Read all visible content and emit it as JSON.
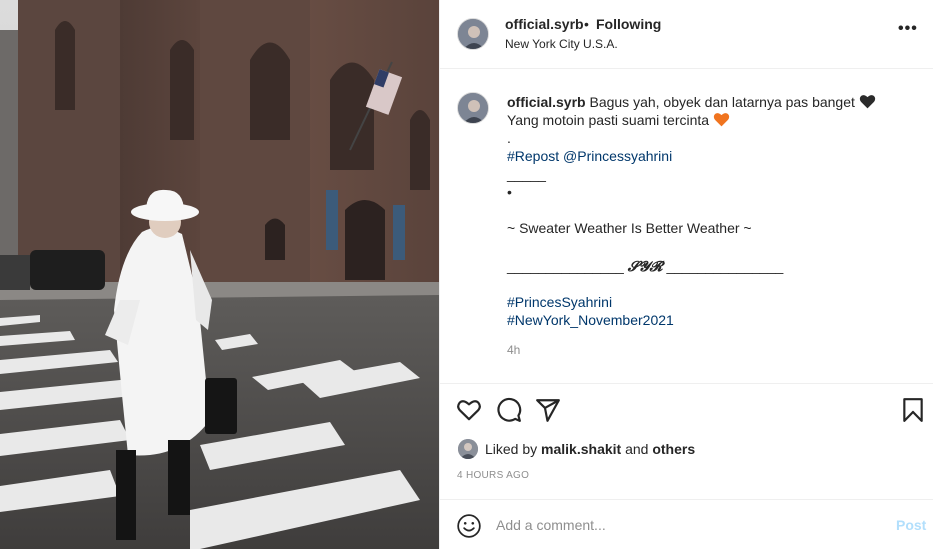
{
  "post": {
    "username": "official.syrb",
    "separator": "•",
    "follow_status": "Following",
    "location": "New York City U.S.A.",
    "more_label": "•••"
  },
  "caption": {
    "username": "official.syrb",
    "line1_text": "Bagus yah, obyek dan latarnya pas banget",
    "line2_text": "Yang motoin pasti suami tercinta",
    "line3": ".",
    "repost_tag": "#Repost",
    "repost_mention": "@Princessyahrini",
    "line5": "_____",
    "line6": "•",
    "line8": "~ Sweater Weather Is Better Weather ~",
    "syr_left": "_______________",
    "syr_mid": "𝓢𝓨𝓡",
    "syr_right": "_______________",
    "hashtag1": "#PrincesSyahrini",
    "hashtag2": "#NewYork_November2021",
    "time": "4h"
  },
  "actions": {
    "like_icon": "heart-outline-icon",
    "comment_icon": "comment-bubble-icon",
    "share_icon": "paper-plane-icon",
    "save_icon": "bookmark-icon"
  },
  "likes": {
    "prefix": "Liked by",
    "user": "malik.shakit",
    "conjunction": "and",
    "others": "others"
  },
  "posted_time": "4 HOURS AGO",
  "comment_box": {
    "placeholder": "Add a comment...",
    "post_label": "Post",
    "emoji_icon": "smiley-icon"
  },
  "colors": {
    "text": "#262626",
    "hashtag": "#00376b",
    "muted": "#8e8e8e",
    "post_disabled": "#b2dffc",
    "heart_orange": "#f0741f"
  }
}
